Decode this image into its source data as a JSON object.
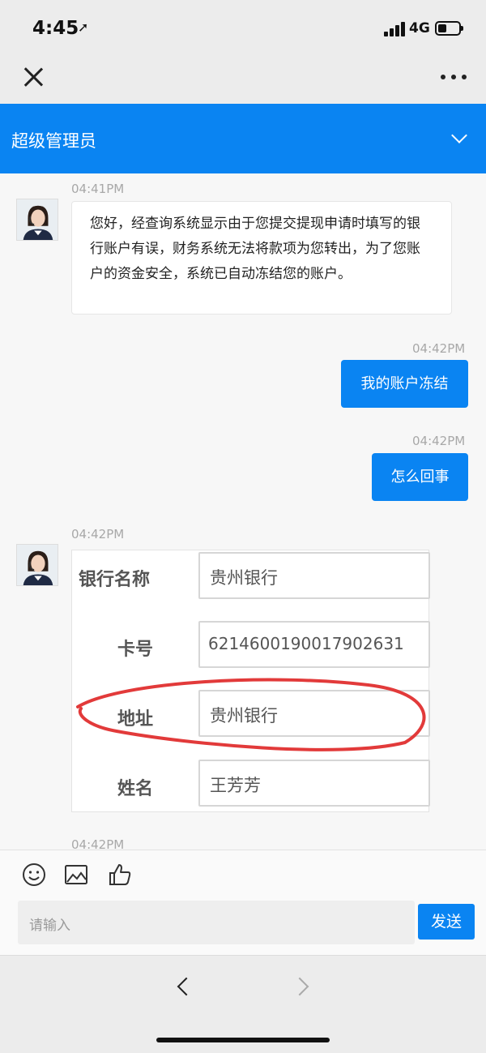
{
  "status": {
    "time": "4:45",
    "network": "4G",
    "battery_level": 0.35
  },
  "nav": {
    "close_icon": "close-icon",
    "more_icon": "more-icon"
  },
  "chat": {
    "title": "超级管理员",
    "accent": "#0a84f2"
  },
  "messages": [
    {
      "side": "left",
      "time": "04:41PM",
      "text": "您好，经查询系统显示由于您提交提现申请时填写的银行账户有误，财务系统无法将款项为您转出，为了您账户的资金安全，系统已自动冻结您的账户。"
    },
    {
      "side": "right",
      "time": "04:42PM",
      "text": "我的账户冻结"
    },
    {
      "side": "right",
      "time": "04:42PM",
      "text": "怎么回事"
    },
    {
      "side": "left",
      "time": "04:42PM",
      "type": "image-card"
    },
    {
      "side": "left",
      "time": "04:42PM"
    }
  ],
  "card": {
    "rows": [
      {
        "label": "银行名称",
        "value": "贵州银行"
      },
      {
        "label": "卡号",
        "value": "6214600190017902631"
      },
      {
        "label": "地址",
        "value": "贵州银行"
      },
      {
        "label": "姓名",
        "value": "王芳芳"
      }
    ],
    "annotation_color": "#e23a3a"
  },
  "composer": {
    "placeholder": "请输入",
    "send_label": "发送",
    "icons": [
      "emoji-icon",
      "image-icon",
      "thumbs-up-icon"
    ]
  },
  "browser": {
    "back_icon": "back-icon",
    "forward_icon": "forward-icon"
  }
}
